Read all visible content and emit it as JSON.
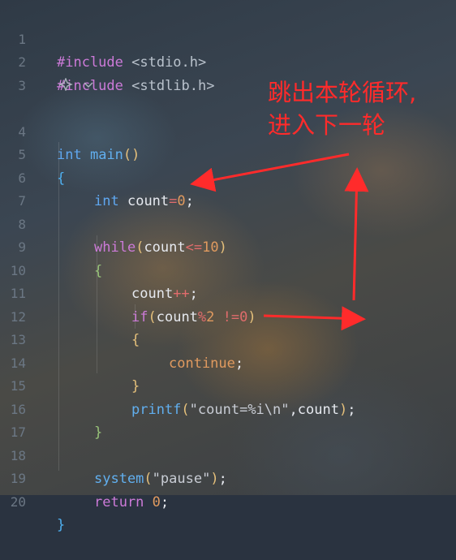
{
  "editor": {
    "lines": [
      {
        "n": "1"
      },
      {
        "n": "2"
      },
      {
        "n": "3"
      },
      {
        "n": "4"
      },
      {
        "n": "5"
      },
      {
        "n": "6"
      },
      {
        "n": "7"
      },
      {
        "n": "8"
      },
      {
        "n": "9"
      },
      {
        "n": "10"
      },
      {
        "n": "11"
      },
      {
        "n": "12"
      },
      {
        "n": "13"
      },
      {
        "n": "14"
      },
      {
        "n": "15"
      },
      {
        "n": "16"
      },
      {
        "n": "17"
      },
      {
        "n": "18"
      },
      {
        "n": "19"
      },
      {
        "n": "20"
      }
    ],
    "code": {
      "l1_kw": "#include",
      "l1_rest": " <stdio.h>",
      "l2_kw": "#include",
      "l2_rest": " <stdlib.h>",
      "l4_type": "int",
      "l4_fn": "main",
      "l4_paren": "()",
      "l5": "{",
      "l6_type": "int",
      "l6_var": "count",
      "l6_op": "=",
      "l6_num": "0",
      "l6_semi": ";",
      "l8_kw": "while",
      "l8_open": "(",
      "l8_var": "count",
      "l8_op": "<=",
      "l8_num": "10",
      "l8_close": ")",
      "l9": "{",
      "l10_var": "count",
      "l10_op": "++",
      "l10_semi": ";",
      "l11_kw": "if",
      "l11_open": "(",
      "l11_var": "count",
      "l11_op": "%",
      "l11_num": "2",
      "l11_rest": " !=0",
      "l11_close": ")",
      "l12": "{",
      "l13_kw": "continue",
      "l13_semi": ";",
      "l14": "}",
      "l15_fn": "printf",
      "l15_open": "(",
      "l15_str": "\"count=%i\\n\"",
      "l15_comma": ",",
      "l15_var": "count",
      "l15_close": ")",
      "l15_semi": ";",
      "l16": "}",
      "l18_fn": "system",
      "l18_open": "(",
      "l18_str": "\"pause\"",
      "l18_close": ")",
      "l18_semi": ";",
      "l19_kw": "return",
      "l19_num": "0",
      "l19_semi": ";",
      "l20": "}"
    },
    "hint_icons": [
      "ai-sparkle-icon",
      "chevron-down-icon"
    ]
  },
  "annotation": {
    "line1": "跳出本轮循环,",
    "line2": "进入下一轮",
    "color": "#ff2b2b"
  }
}
